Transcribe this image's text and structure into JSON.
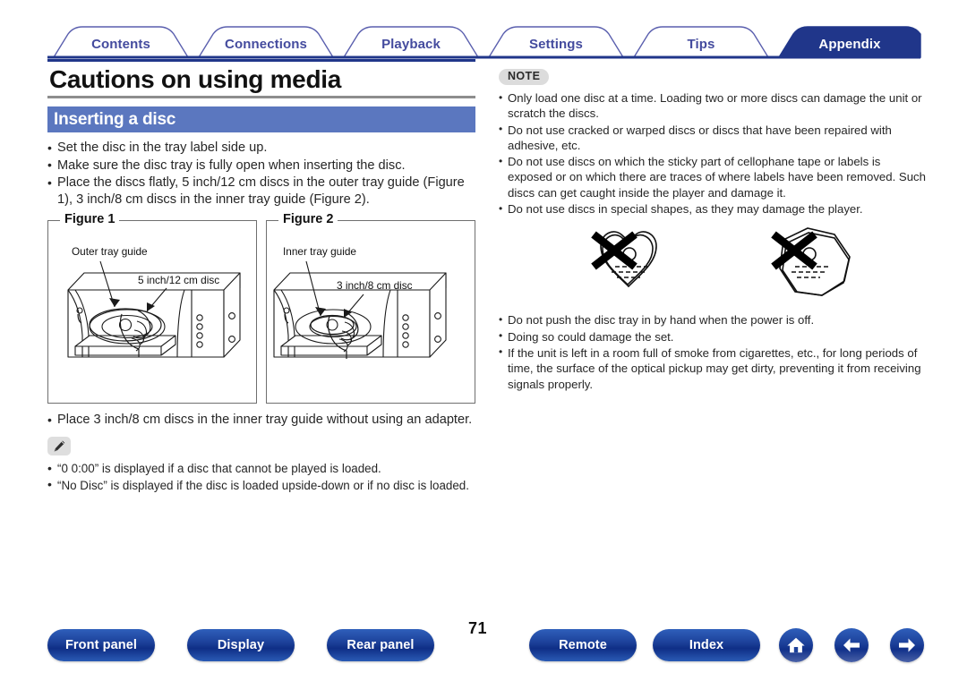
{
  "tabs": [
    {
      "label": "Contents",
      "active": false
    },
    {
      "label": "Connections",
      "active": false
    },
    {
      "label": "Playback",
      "active": false
    },
    {
      "label": "Settings",
      "active": false
    },
    {
      "label": "Tips",
      "active": false
    },
    {
      "label": "Appendix",
      "active": true
    }
  ],
  "page": {
    "title": "Cautions on using media",
    "number": "71"
  },
  "section": {
    "heading": "Inserting a disc",
    "bullets": [
      "Set the disc in the tray label side up.",
      "Make sure the disc tray is fully open when inserting the disc.",
      "Place the discs flatly, 5 inch/12 cm discs in the outer tray guide (Figure 1), 3 inch/8 cm discs in the inner tray guide (Figure 2)."
    ],
    "after_figures_bullet": "Place 3 inch/8 cm discs in the inner tray guide without using an adapter."
  },
  "figures": [
    {
      "legend": "Figure 1",
      "callout_top": "Outer tray guide",
      "callout_bottom": "5 inch/12 cm disc"
    },
    {
      "legend": "Figure 2",
      "callout_top": "Inner tray guide",
      "callout_bottom": "3 inch/8 cm disc"
    }
  ],
  "tip": {
    "icon": "pencil-icon",
    "bullets": [
      "“0 0:00” is displayed if a disc that cannot be played is loaded.",
      "“No Disc” is displayed if the disc is loaded upside-down or if no disc is loaded."
    ]
  },
  "note": {
    "badge": "NOTE",
    "bullets_before_shapes": [
      "Only load one disc at a time. Loading two or more discs can damage the unit or scratch the discs.",
      "Do not use cracked or warped discs or discs that have been repaired with adhesive, etc.",
      "Do not use discs on which the sticky part of cellophane tape or labels is exposed or on which there are traces of where labels have been removed. Such discs can get caught inside the player and damage it.",
      "Do not use discs in special shapes, as they may damage the player."
    ],
    "shapes": [
      {
        "name": "heart-shaped-disc",
        "forbidden": true
      },
      {
        "name": "octagon-shaped-disc",
        "forbidden": true
      }
    ],
    "bullets_after_shapes": [
      "Do not push the disc tray in by hand when the power is off.",
      "Doing so could damage the set.",
      "If the unit is left in a room full of smoke from cigarettes, etc., for long periods of time, the surface of the optical pickup may get dirty, preventing it from receiving signals properly."
    ]
  },
  "footer": {
    "buttons": [
      {
        "label": "Front panel"
      },
      {
        "label": "Display"
      },
      {
        "label": "Rear panel"
      },
      {
        "label": "Remote"
      },
      {
        "label": "Index"
      }
    ],
    "icons": [
      {
        "name": "home-icon"
      },
      {
        "name": "arrow-left-icon"
      },
      {
        "name": "arrow-right-icon"
      }
    ]
  },
  "colors": {
    "tab_active_bg": "#20368a",
    "tab_text": "#444b9e",
    "section_heading_bg": "#5b77bf",
    "title_rule_top": "#20368a",
    "title_rule_bottom": "#8d8d8d",
    "badge_bg": "#dcdcdc",
    "button_blue": "#1c4099"
  }
}
